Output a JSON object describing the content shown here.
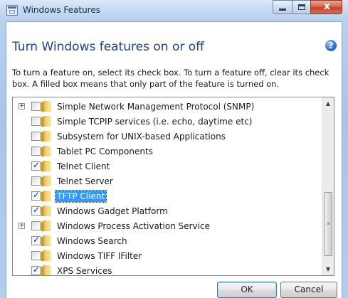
{
  "window": {
    "title": "Windows Features",
    "close_glyph": "x",
    "help_glyph": "?"
  },
  "heading": "Turn Windows features on or off",
  "description": "To turn a feature on, select its check box. To turn a feature off, clear its check box. A filled box means that only part of the feature is turned on.",
  "features": [
    {
      "label": "Simple Network Management Protocol (SNMP)",
      "checked": false,
      "expandable": true,
      "selected": false
    },
    {
      "label": "Simple TCPIP services (i.e. echo, daytime etc)",
      "checked": false,
      "expandable": false,
      "selected": false
    },
    {
      "label": "Subsystem for UNIX-based Applications",
      "checked": false,
      "expandable": false,
      "selected": false
    },
    {
      "label": "Tablet PC Components",
      "checked": false,
      "expandable": false,
      "selected": false
    },
    {
      "label": "Telnet Client",
      "checked": true,
      "expandable": false,
      "selected": false
    },
    {
      "label": "Telnet Server",
      "checked": false,
      "expandable": false,
      "selected": false
    },
    {
      "label": "TFTP Client",
      "checked": true,
      "expandable": false,
      "selected": true
    },
    {
      "label": "Windows Gadget Platform",
      "checked": true,
      "expandable": false,
      "selected": false
    },
    {
      "label": "Windows Process Activation Service",
      "checked": false,
      "expandable": true,
      "selected": false
    },
    {
      "label": "Windows Search",
      "checked": true,
      "expandable": false,
      "selected": false
    },
    {
      "label": "Windows TIFF IFilter",
      "checked": false,
      "expandable": false,
      "selected": false
    },
    {
      "label": "XPS Services",
      "checked": true,
      "expandable": false,
      "selected": false
    }
  ],
  "buttons": {
    "ok_label": "OK",
    "cancel_label": "Cancel"
  },
  "colors": {
    "heading": "#1f3f91",
    "selection": "#3399ff"
  }
}
